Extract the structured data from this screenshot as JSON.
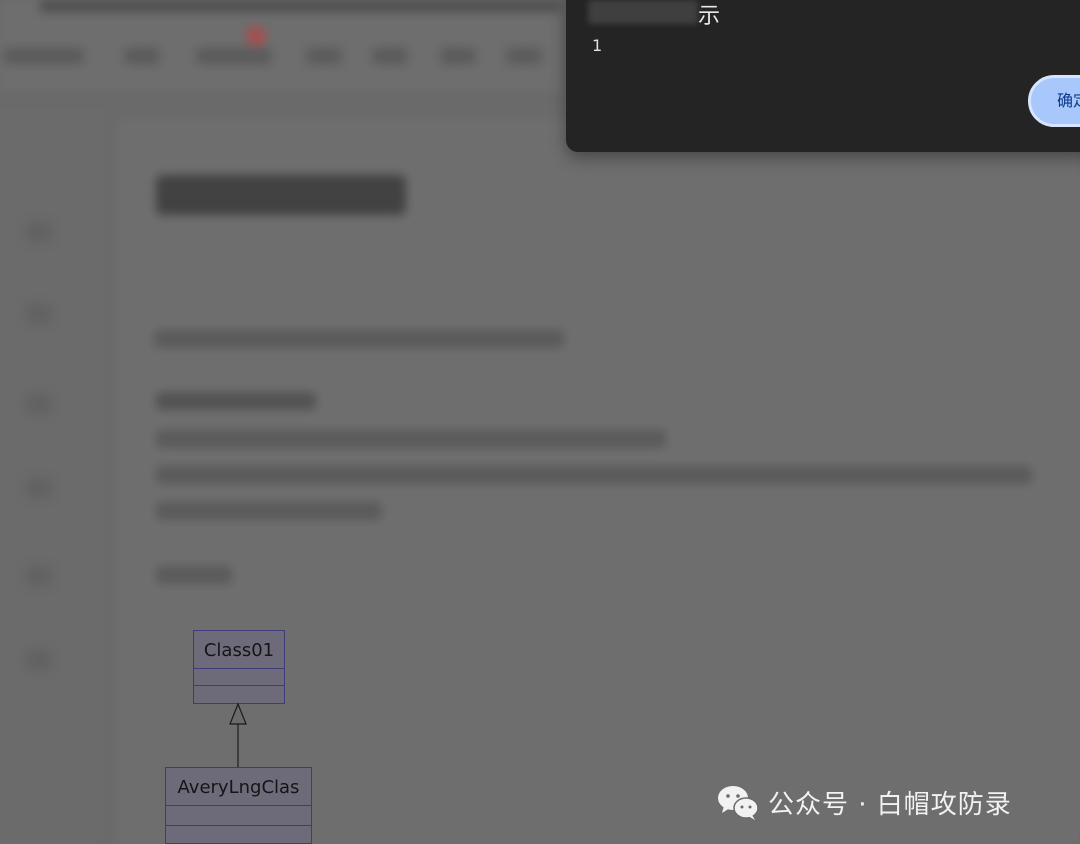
{
  "dialog": {
    "title_visible_suffix": "示",
    "message": "1",
    "confirm_label": "确定"
  },
  "diagram": {
    "parent_class": "Class01",
    "child_class": "AveryLngClas"
  },
  "watermark": {
    "text": "公众号 · 白帽攻防录"
  },
  "colors": {
    "overlay": "#6b6b6b",
    "dialog_bg": "#242424",
    "confirm_button": "#a8c7fa",
    "uml_border": "#3f3c7a"
  }
}
